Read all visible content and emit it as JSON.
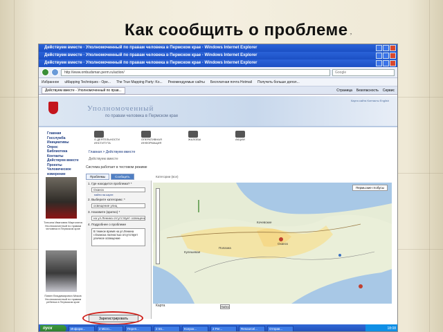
{
  "slide": {
    "title": "Как сообщить о проблеме",
    "title_q": "?"
  },
  "window": {
    "titles": [
      "Действуем вместе · Уполномоченный по правам человека в Пермском крае · Windows Internet Explorer",
      "Действуем вместе · Уполномоченный по правам человека в Пермском крае · Windows Internet Explorer",
      "Действуем вместе · Уполномоченный по правам человека в Пермском крае · Windows Internet Explorer"
    ],
    "address": "http://www.ombudsman.perm.ru/action/",
    "search_placeholder": "Google",
    "favorites": [
      "Избранное",
      "uMapping Techniques - Ope...",
      "The True Mapping Party: Ko...",
      "Рекомендуемые сайты",
      "Бесплатная почта Hotmail",
      "Получить больше допол..."
    ],
    "tab_label": "Действуем вместе - Уполномоченный по прав...",
    "tools": [
      "Страница",
      "Безопасность",
      "Сервис"
    ]
  },
  "site": {
    "title": "Уполномоченный",
    "subtitle": "по правам человека в Пермском крае",
    "head_links": "Карта сайта   Контакты   English",
    "menu": [
      "Главная",
      "Госслужба",
      "Инициативы",
      "Опрос",
      "Библиотека",
      "Контакты",
      "Действуем вместе",
      "Проекты",
      "Человеческое измерение"
    ],
    "person1": "Татьяна Ивановна Марголина Уполномоченный по правам человека в Пермском крае",
    "person2": "Павел Владимирович Миков Уполномоченный по правам ребенка в Пермском крае",
    "icons": [
      "О ДЕЯТЕЛЬНОСТИ ИНСТИТУТА",
      "ОПЕРАТИВНАЯ ИНФОРМАЦИЯ",
      "ЖАЛОБЫ",
      "АКЦИИ"
    ],
    "breadcrumb": "Главная > Действуем вместе",
    "crumb_tag": "Действуем вместе",
    "status": "Система работает в тестовом режиме",
    "tabs": [
      "Проблемы",
      "Сообщить"
    ]
  },
  "form": {
    "q1": "1. Где находится проблема? *",
    "a1": "Оханск",
    "link1": "найти на карте",
    "q2": "2. Выберите категорию: *",
    "a2": "освещение улиц",
    "q3": "3. Назовите (кратко) *",
    "a3": "на ул.Ленина отсутствует освещение",
    "q4": "4. Подробнее о проблеме",
    "a4": "В темное время на ул.Ленина г.Оханска полностью отсутствует уличное освещение",
    "submit": "Зарегистрировать"
  },
  "map": {
    "category_label": "Категории (все)",
    "type_label": "Пермьские глобусы",
    "places": [
      "Оханск",
      "Кочевские",
      "Полазна",
      "Кулешевая"
    ],
    "footer_left": "Карта",
    "search_btn": "Найти"
  },
  "status_bar": {
    "text": "Готово",
    "zone": "Интернет",
    "zoom": "100%"
  },
  "taskbar": {
    "start": "пуск",
    "tasks": [
      "Информ...",
      "2 Micro...",
      "Переп...",
      "2 Int...",
      "Ксерок...",
      "2 Per...",
      "Resourcel...",
      "Отправ..."
    ],
    "clock": "18:08"
  }
}
